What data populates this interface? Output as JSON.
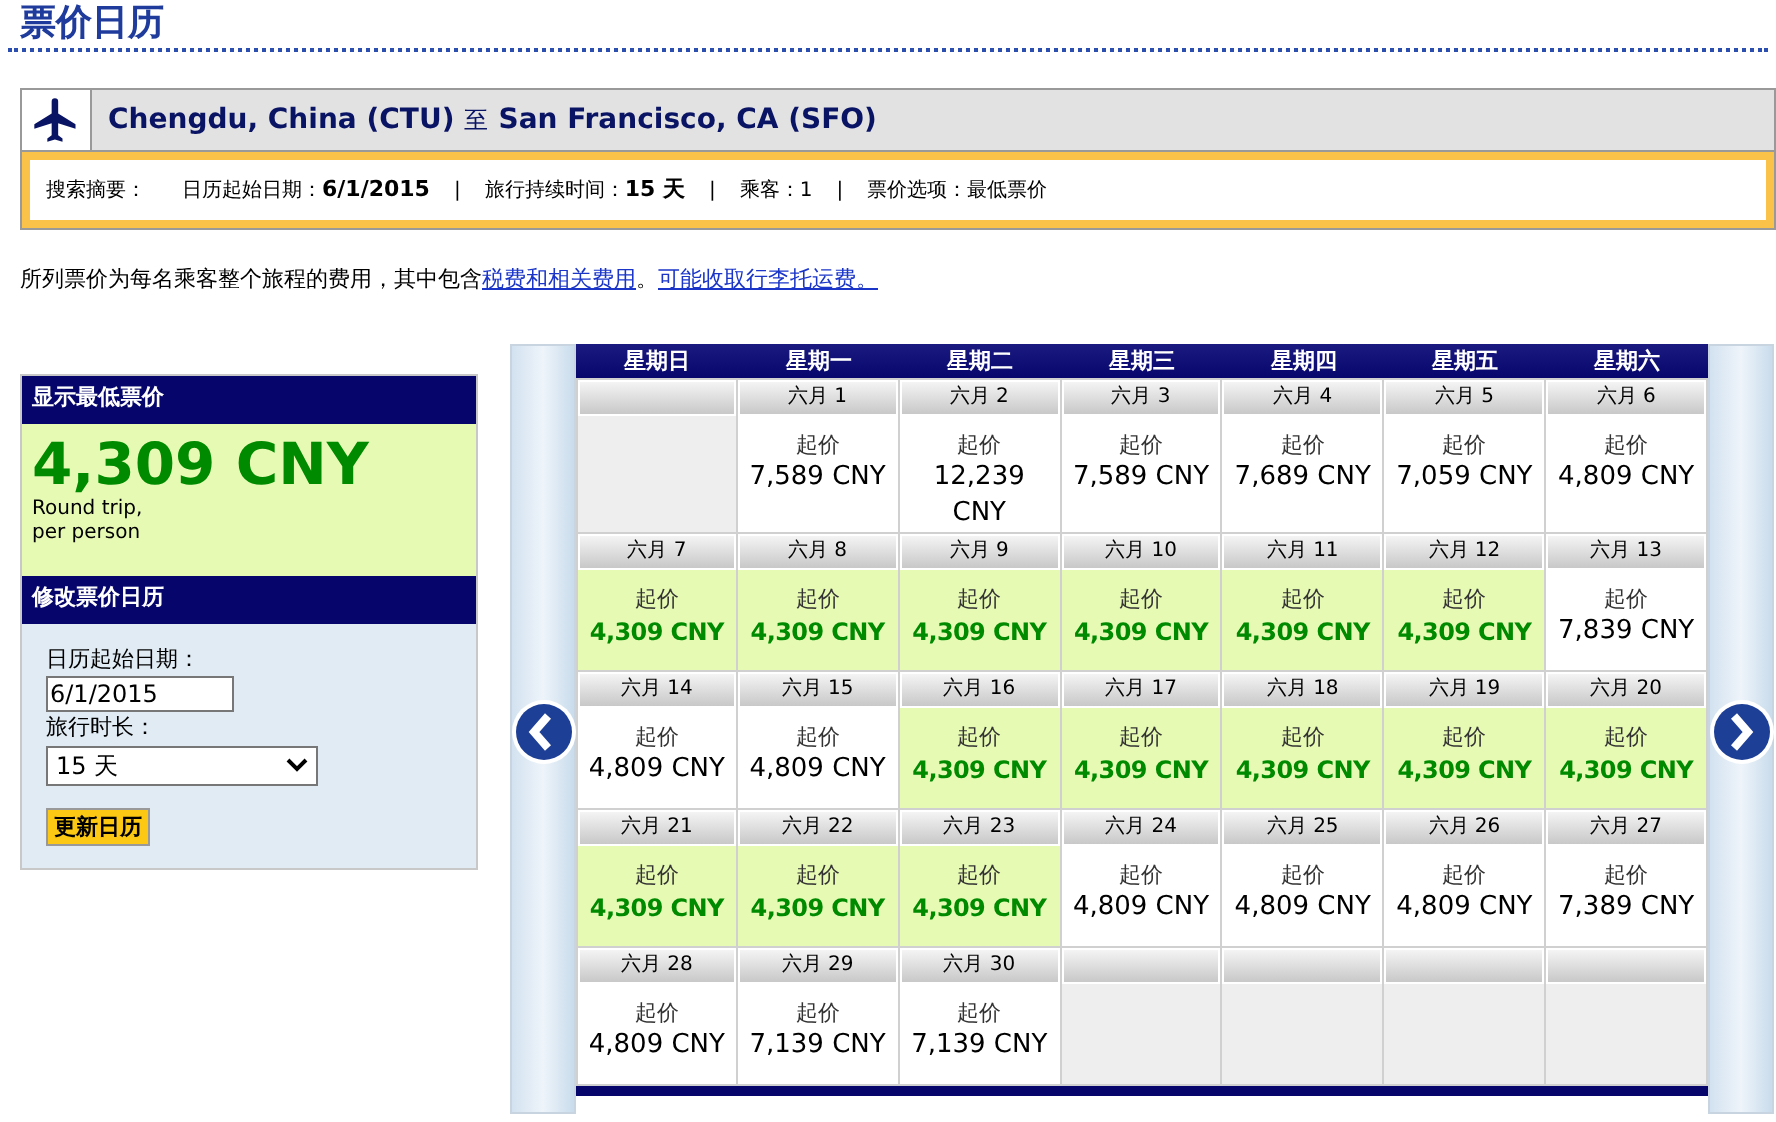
{
  "page_title": "票价日历",
  "route": {
    "origin": "Chengdu, China (CTU)",
    "connector": "至",
    "destination": "San Francisco, CA (SFO)"
  },
  "summary": {
    "label": "搜索摘要：",
    "items": [
      {
        "label": "日历起始日期：",
        "value": "6/1/2015",
        "emphasis": true
      },
      {
        "label": "旅行持续时间：",
        "value": "15 天",
        "emphasis": true
      },
      {
        "label": "乘客：",
        "value": "1",
        "emphasis": false
      },
      {
        "label": "票价选项：",
        "value": "最低票价",
        "emphasis": false
      }
    ],
    "separator": "|"
  },
  "note": {
    "text": "所列票价为每名乘客整个旅程的费用，其中包含",
    "link1": "税费和相关费用",
    "middle": "。",
    "link2": "可能收取行李托运费。"
  },
  "lowest_panel": {
    "title": "显示最低票价",
    "price": "4,309 CNY",
    "caption": [
      "Round trip,",
      "per person"
    ]
  },
  "modify_panel": {
    "title": "修改票价日历",
    "start_label": "日历起始日期：",
    "start_value": "6/1/2015",
    "duration_label": "旅行时长：",
    "duration_value": "15 天",
    "button": "更新日历"
  },
  "calendar": {
    "weekdays": [
      "星期日",
      "星期一",
      "星期二",
      "星期三",
      "星期四",
      "星期五",
      "星期六"
    ],
    "weeks": [
      [
        {
          "kind": "empty"
        },
        {
          "kind": "day",
          "date": "六月 1",
          "label": "起价",
          "price": "7,589 CNY",
          "lowest": false
        },
        {
          "kind": "day",
          "date": "六月 2",
          "label": "起价",
          "price": "12,239 CNY",
          "lowest": false
        },
        {
          "kind": "day",
          "date": "六月 3",
          "label": "起价",
          "price": "7,589 CNY",
          "lowest": false
        },
        {
          "kind": "day",
          "date": "六月 4",
          "label": "起价",
          "price": "7,689 CNY",
          "lowest": false
        },
        {
          "kind": "day",
          "date": "六月 5",
          "label": "起价",
          "price": "7,059 CNY",
          "lowest": false
        },
        {
          "kind": "day",
          "date": "六月 6",
          "label": "起价",
          "price": "4,809 CNY",
          "lowest": false
        }
      ],
      [
        {
          "kind": "day",
          "date": "六月 7",
          "label": "起价",
          "price": "4,309 CNY",
          "lowest": true
        },
        {
          "kind": "day",
          "date": "六月 8",
          "label": "起价",
          "price": "4,309 CNY",
          "lowest": true
        },
        {
          "kind": "day",
          "date": "六月 9",
          "label": "起价",
          "price": "4,309 CNY",
          "lowest": true
        },
        {
          "kind": "day",
          "date": "六月 10",
          "label": "起价",
          "price": "4,309 CNY",
          "lowest": true
        },
        {
          "kind": "day",
          "date": "六月 11",
          "label": "起价",
          "price": "4,309 CNY",
          "lowest": true
        },
        {
          "kind": "day",
          "date": "六月 12",
          "label": "起价",
          "price": "4,309 CNY",
          "lowest": true
        },
        {
          "kind": "day",
          "date": "六月 13",
          "label": "起价",
          "price": "7,839 CNY",
          "lowest": false
        }
      ],
      [
        {
          "kind": "day",
          "date": "六月 14",
          "label": "起价",
          "price": "4,809 CNY",
          "lowest": false
        },
        {
          "kind": "day",
          "date": "六月 15",
          "label": "起价",
          "price": "4,809 CNY",
          "lowest": false
        },
        {
          "kind": "day",
          "date": "六月 16",
          "label": "起价",
          "price": "4,309 CNY",
          "lowest": true
        },
        {
          "kind": "day",
          "date": "六月 17",
          "label": "起价",
          "price": "4,309 CNY",
          "lowest": true
        },
        {
          "kind": "day",
          "date": "六月 18",
          "label": "起价",
          "price": "4,309 CNY",
          "lowest": true
        },
        {
          "kind": "day",
          "date": "六月 19",
          "label": "起价",
          "price": "4,309 CNY",
          "lowest": true
        },
        {
          "kind": "day",
          "date": "六月 20",
          "label": "起价",
          "price": "4,309 CNY",
          "lowest": true
        }
      ],
      [
        {
          "kind": "day",
          "date": "六月 21",
          "label": "起价",
          "price": "4,309 CNY",
          "lowest": true
        },
        {
          "kind": "day",
          "date": "六月 22",
          "label": "起价",
          "price": "4,309 CNY",
          "lowest": true
        },
        {
          "kind": "day",
          "date": "六月 23",
          "label": "起价",
          "price": "4,309 CNY",
          "lowest": true
        },
        {
          "kind": "day",
          "date": "六月 24",
          "label": "起价",
          "price": "4,809 CNY",
          "lowest": false
        },
        {
          "kind": "day",
          "date": "六月 25",
          "label": "起价",
          "price": "4,809 CNY",
          "lowest": false
        },
        {
          "kind": "day",
          "date": "六月 26",
          "label": "起价",
          "price": "4,809 CNY",
          "lowest": false
        },
        {
          "kind": "day",
          "date": "六月 27",
          "label": "起价",
          "price": "7,389 CNY",
          "lowest": false
        }
      ],
      [
        {
          "kind": "day",
          "date": "六月 28",
          "label": "起价",
          "price": "4,809 CNY",
          "lowest": false
        },
        {
          "kind": "day",
          "date": "六月 29",
          "label": "起价",
          "price": "7,139 CNY",
          "lowest": false
        },
        {
          "kind": "day",
          "date": "六月 30",
          "label": "起价",
          "price": "7,139 CNY",
          "lowest": false
        },
        {
          "kind": "empty"
        },
        {
          "kind": "empty"
        },
        {
          "kind": "empty"
        },
        {
          "kind": "empty"
        }
      ]
    ]
  }
}
